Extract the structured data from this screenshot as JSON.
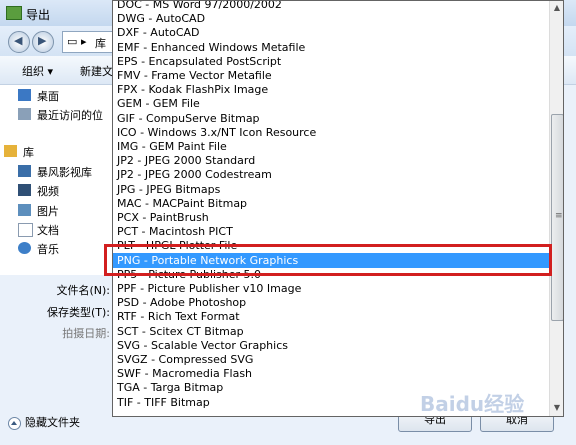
{
  "window": {
    "title": "导出"
  },
  "address": {
    "crumb": "库"
  },
  "toolbar": {
    "organize": "组织 ▾",
    "new_folder": "新建文"
  },
  "nav": {
    "desktop": "桌面",
    "recent": "最近访问的位",
    "library": "库",
    "video_lib": "暴风影视库",
    "videos": "视频",
    "pictures": "图片",
    "documents": "文档",
    "music": "音乐"
  },
  "form": {
    "filename_label": "文件名(N):",
    "savetype_label": "保存类型(T):",
    "date_label": "拍摄日期:"
  },
  "bottom": {
    "hide_folders": "隐藏文件夹",
    "save": "导出",
    "cancel": "取消"
  },
  "dropdown": {
    "selected_index": 17,
    "options": [
      "DOC - MS Word 97/2000/2002",
      "DWG - AutoCAD",
      "DXF - AutoCAD",
      "EMF - Enhanced Windows Metafile",
      "EPS - Encapsulated PostScript",
      "FMV - Frame Vector Metafile",
      "FPX - Kodak FlashPix Image",
      "GEM - GEM File",
      "GIF - CompuServe Bitmap",
      "ICO - Windows 3.x/NT Icon Resource",
      "IMG - GEM Paint File",
      "JP2 - JPEG 2000 Standard",
      "JP2 - JPEG 2000 Codestream",
      "JPG - JPEG Bitmaps",
      "MAC - MACPaint Bitmap",
      "PCX - PaintBrush",
      "PCT - Macintosh PICT",
      "PLT - HPGL Plotter File",
      "PNG - Portable Network Graphics",
      "PP5 - Picture Publisher 5.0",
      "PPF - Picture Publisher v10 Image",
      "PSD - Adobe Photoshop",
      "RTF - Rich Text Format",
      "SCT - Scitex CT Bitmap",
      "SVG - Scalable Vector Graphics",
      "SVGZ - Compressed SVG",
      "SWF - Macromedia Flash",
      "TGA - Targa Bitmap",
      "TIF - TIFF Bitmap"
    ]
  },
  "watermark": "Baidu经验"
}
